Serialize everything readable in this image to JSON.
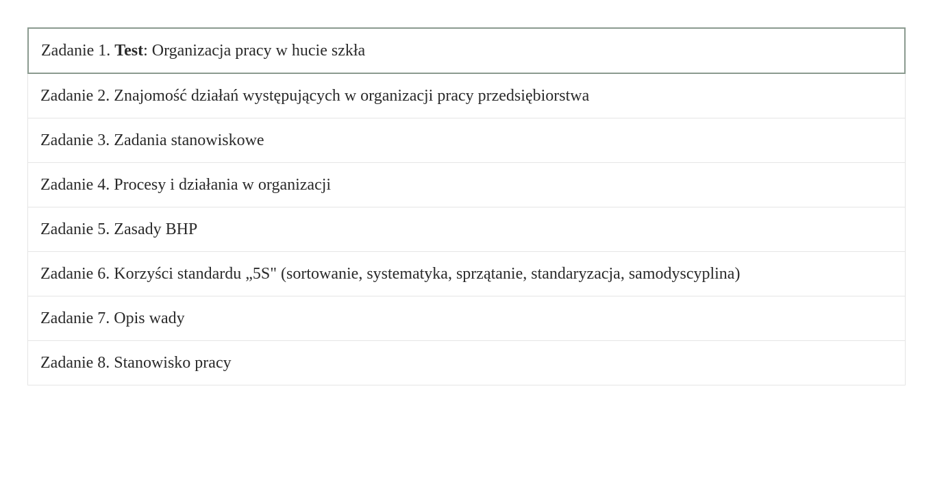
{
  "tasks": [
    {
      "prefix": "Zadanie 1. ",
      "bold": "Test",
      "rest": ": Organizacja pracy w hucie szkła"
    },
    {
      "prefix": "Zadanie 2. Znajomość działań występujących w organizacji pracy przedsiębiorstwa",
      "bold": "",
      "rest": ""
    },
    {
      "prefix": "Zadanie 3. Zadania stanowiskowe",
      "bold": "",
      "rest": ""
    },
    {
      "prefix": "Zadanie 4. Procesy i działania w organizacji",
      "bold": "",
      "rest": ""
    },
    {
      "prefix": "Zadanie 5. Zasady BHP",
      "bold": "",
      "rest": ""
    },
    {
      "prefix": "Zadanie 6. Korzyści standardu „5S\" (sortowanie, systematyka, sprzątanie, standaryzacja, samodyscyplina)",
      "bold": "",
      "rest": ""
    },
    {
      "prefix": "Zadanie 7. Opis wady",
      "bold": "",
      "rest": ""
    },
    {
      "prefix": "Zadanie 8. Stanowisko pracy",
      "bold": "",
      "rest": ""
    }
  ]
}
